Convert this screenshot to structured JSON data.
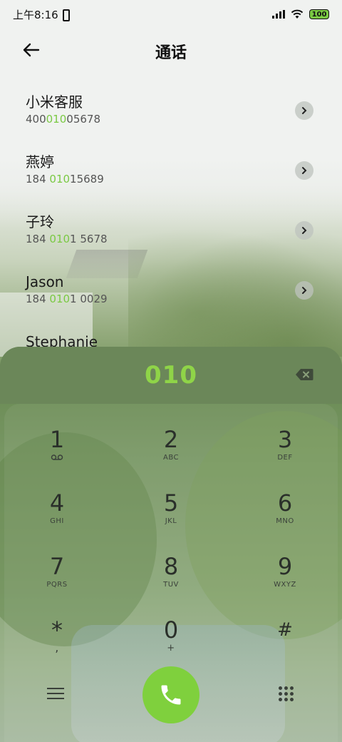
{
  "status_bar": {
    "time": "上午8:16",
    "battery": "100",
    "icons": [
      "vibrate-icon",
      "signal-icon",
      "wifi-icon",
      "battery-icon"
    ]
  },
  "header": {
    "title": "通话",
    "back_icon": "arrow-left-icon"
  },
  "contacts": [
    {
      "name": "小米客服",
      "number_pre": "400",
      "number_match": "010",
      "number_post": "05678"
    },
    {
      "name": "燕婷",
      "number_pre": "184 ",
      "number_match": "010",
      "number_post": "15689"
    },
    {
      "name": "子玲",
      "number_pre": "184 ",
      "number_match": "010",
      "number_post": "1 5678"
    },
    {
      "name": "Jason",
      "number_pre": "184 ",
      "number_match": "010",
      "number_post": "1 0029"
    },
    {
      "name": "Stephanie",
      "number_pre": "",
      "number_match": "",
      "number_post": ""
    }
  ],
  "dialer": {
    "input": "010",
    "keys": [
      [
        {
          "digit": "1",
          "letters": "voicemail-icon"
        },
        {
          "digit": "2",
          "letters": "ABC"
        },
        {
          "digit": "3",
          "letters": "DEF"
        }
      ],
      [
        {
          "digit": "4",
          "letters": "GHI"
        },
        {
          "digit": "5",
          "letters": "JKL"
        },
        {
          "digit": "6",
          "letters": "MNO"
        }
      ],
      [
        {
          "digit": "7",
          "letters": "PQRS"
        },
        {
          "digit": "8",
          "letters": "TUV"
        },
        {
          "digit": "9",
          "letters": "WXYZ"
        }
      ],
      [
        {
          "digit": "*",
          "letters": ","
        },
        {
          "digit": "0",
          "letters": "+"
        },
        {
          "digit": "#",
          "letters": ""
        }
      ]
    ]
  },
  "colors": {
    "accent": "#7ac943",
    "call_button": "#7fd03d",
    "display_bar": "#6b8759"
  }
}
